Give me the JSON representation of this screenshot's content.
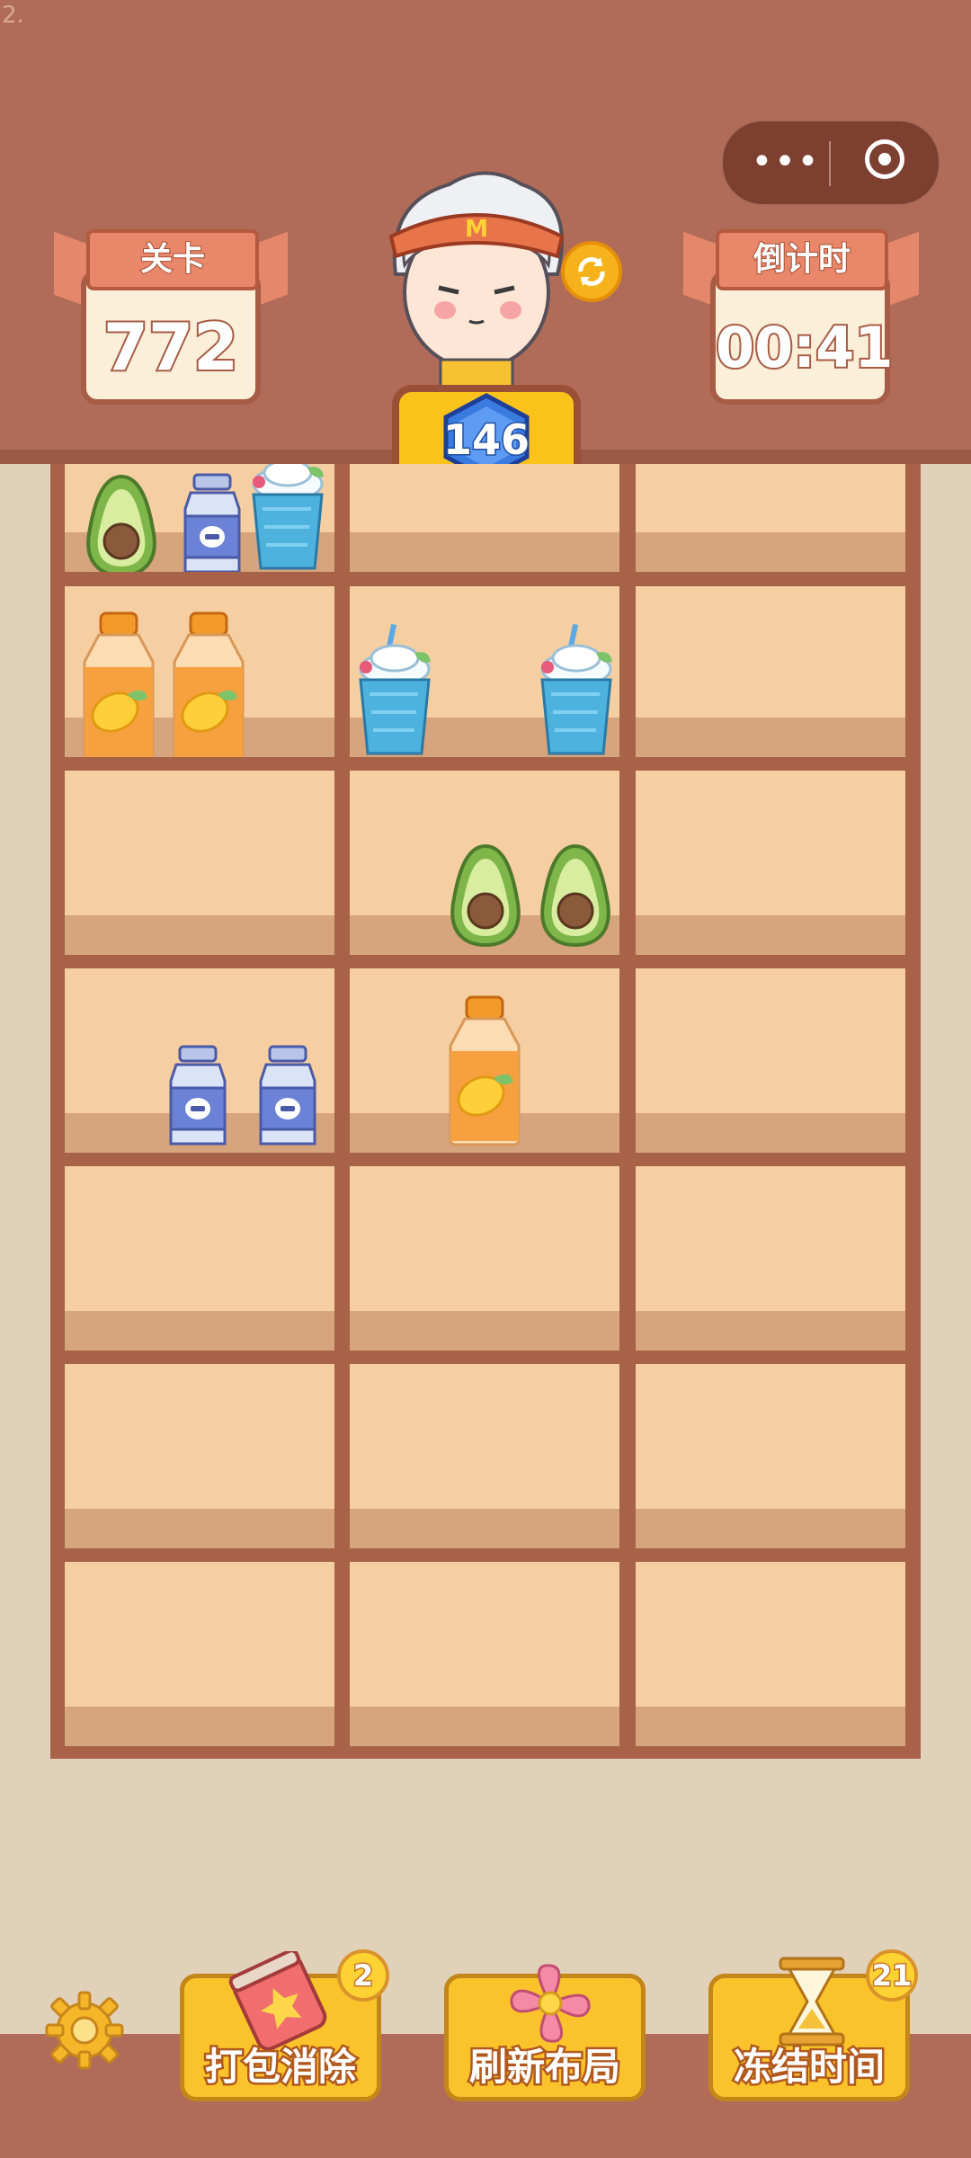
{
  "corner_text": "2.",
  "capsule": {
    "more_icon": "more-dots-icon",
    "close_icon": "target-icon"
  },
  "level": {
    "title": "关卡",
    "value": "772"
  },
  "countdown": {
    "title": "倒计时",
    "value": "00:41"
  },
  "score": {
    "value": "146"
  },
  "tools": [
    {
      "label": "打包消除",
      "count": "2",
      "icon": "soda-can-icon"
    },
    {
      "label": "刷新布局",
      "count": "",
      "icon": "pinwheel-icon"
    },
    {
      "label": "冻结时间",
      "count": "21",
      "icon": "hourglass-icon"
    }
  ],
  "shelf": {
    "rows": 7,
    "cols": 3,
    "items": [
      {
        "row": 0,
        "col": 0,
        "type": "avocado"
      },
      {
        "row": 0,
        "col": 0,
        "type": "milk-bottle"
      },
      {
        "row": 0,
        "col": 0,
        "type": "blue-smoothie"
      },
      {
        "row": 1,
        "col": 0,
        "type": "mango-juice"
      },
      {
        "row": 1,
        "col": 0,
        "type": "mango-juice"
      },
      {
        "row": 1,
        "col": 1,
        "type": "blue-smoothie"
      },
      {
        "row": 1,
        "col": 1,
        "type": "blue-smoothie"
      },
      {
        "row": 2,
        "col": 1,
        "type": "avocado"
      },
      {
        "row": 2,
        "col": 1,
        "type": "avocado"
      },
      {
        "row": 3,
        "col": 0,
        "type": "milk-bottle"
      },
      {
        "row": 3,
        "col": 0,
        "type": "milk-bottle"
      },
      {
        "row": 3,
        "col": 1,
        "type": "mango-juice"
      }
    ]
  },
  "colors": {
    "header": "#b06c58",
    "shelf_frame": "#a76248",
    "shelf_cell": "#f5cfa2",
    "tool_bg": "#fbc32b"
  }
}
